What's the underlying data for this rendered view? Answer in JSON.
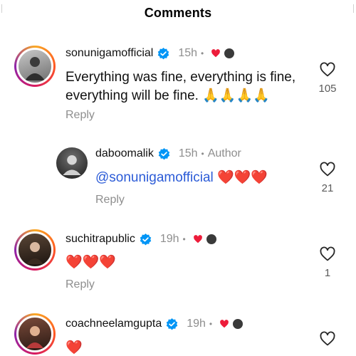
{
  "header": {
    "title": "Comments"
  },
  "comments": [
    {
      "username": "sonunigamofficial",
      "time": "15h",
      "text": "Everything was fine, everything is fine, everything will be fine. 🙏🙏🙏🙏",
      "text_line1": "Everything was fine, everything is fine,",
      "text_line2": "everything will be fine. 🙏🙏🙏🙏",
      "reply_label": "Reply",
      "likes": "105"
    },
    {
      "username": "daboomalik",
      "time": "15h",
      "author_label": "Author",
      "mention": "@sonunigamofficial",
      "text": "❤️❤️❤️",
      "reply_label": "Reply",
      "likes": "21"
    },
    {
      "username": "suchitrapublic",
      "time": "19h",
      "text": "❤️❤️❤️",
      "reply_label": "Reply",
      "likes": "1"
    },
    {
      "username": "coachneelamgupta",
      "time": "19h",
      "text": "❤️"
    }
  ],
  "colors": {
    "verified_blue": "#0095f6",
    "heart_red": "#ed1c3a",
    "mention_blue": "#2b5bd7",
    "muted_gray": "#8e8e8e"
  },
  "icons": [
    "verified-badge-icon",
    "heart-icon",
    "like-outline-icon"
  ]
}
